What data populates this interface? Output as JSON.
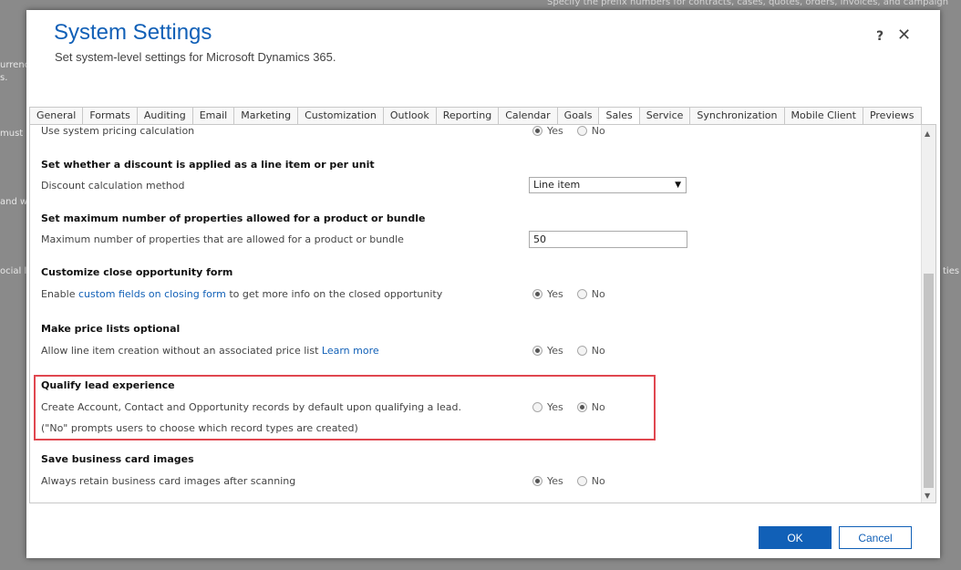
{
  "background": {
    "top_text": "Specify the prefix numbers for contracts, cases, quotes, orders, invoices, and campaign",
    "fragments": [
      "urrenc",
      "s.",
      "must",
      "and w",
      "ocial l",
      "ties in"
    ]
  },
  "dialog": {
    "title": "System Settings",
    "subtitle": "Set system-level settings for Microsoft Dynamics 365.",
    "help": "?",
    "close": "✕"
  },
  "tabs": [
    {
      "label": "General"
    },
    {
      "label": "Formats"
    },
    {
      "label": "Auditing"
    },
    {
      "label": "Email"
    },
    {
      "label": "Marketing"
    },
    {
      "label": "Customization"
    },
    {
      "label": "Outlook"
    },
    {
      "label": "Reporting"
    },
    {
      "label": "Calendar"
    },
    {
      "label": "Goals"
    },
    {
      "label": "Sales",
      "active": true
    },
    {
      "label": "Service"
    },
    {
      "label": "Synchronization"
    },
    {
      "label": "Mobile Client"
    },
    {
      "label": "Previews"
    }
  ],
  "radio": {
    "yes": "Yes",
    "no": "No"
  },
  "settings": {
    "pricing": {
      "label": "Use system pricing calculation",
      "value": "Yes"
    },
    "discount": {
      "heading": "Set whether a discount is applied as a line item or per unit",
      "label": "Discount calculation method",
      "value": "Line item"
    },
    "max_props": {
      "heading": "Set maximum number of properties allowed for a product or bundle",
      "label": "Maximum number of properties that are allowed for a product or bundle",
      "value": "50"
    },
    "close_opp": {
      "heading": "Customize close opportunity form",
      "label_pre": "Enable",
      "label_link": "custom fields on closing form",
      "label_post": "to get more info on the closed opportunity",
      "value": "Yes"
    },
    "price_lists": {
      "heading": "Make price lists optional",
      "label": "Allow line item creation without an associated price list",
      "link": "Learn more",
      "value": "Yes"
    },
    "qualify_lead": {
      "heading": "Qualify lead experience",
      "label": "Create Account, Contact and Opportunity records by default upon qualifying a lead.",
      "note": "(\"No\" prompts users to choose which record types are created)",
      "value": "No"
    },
    "business_card": {
      "heading": "Save business card images",
      "label": "Always retain business card images after scanning",
      "value": "Yes"
    }
  },
  "footer": {
    "ok": "OK",
    "cancel": "Cancel"
  },
  "colors": {
    "accent": "#1160b7",
    "highlight": "#e0474f"
  }
}
